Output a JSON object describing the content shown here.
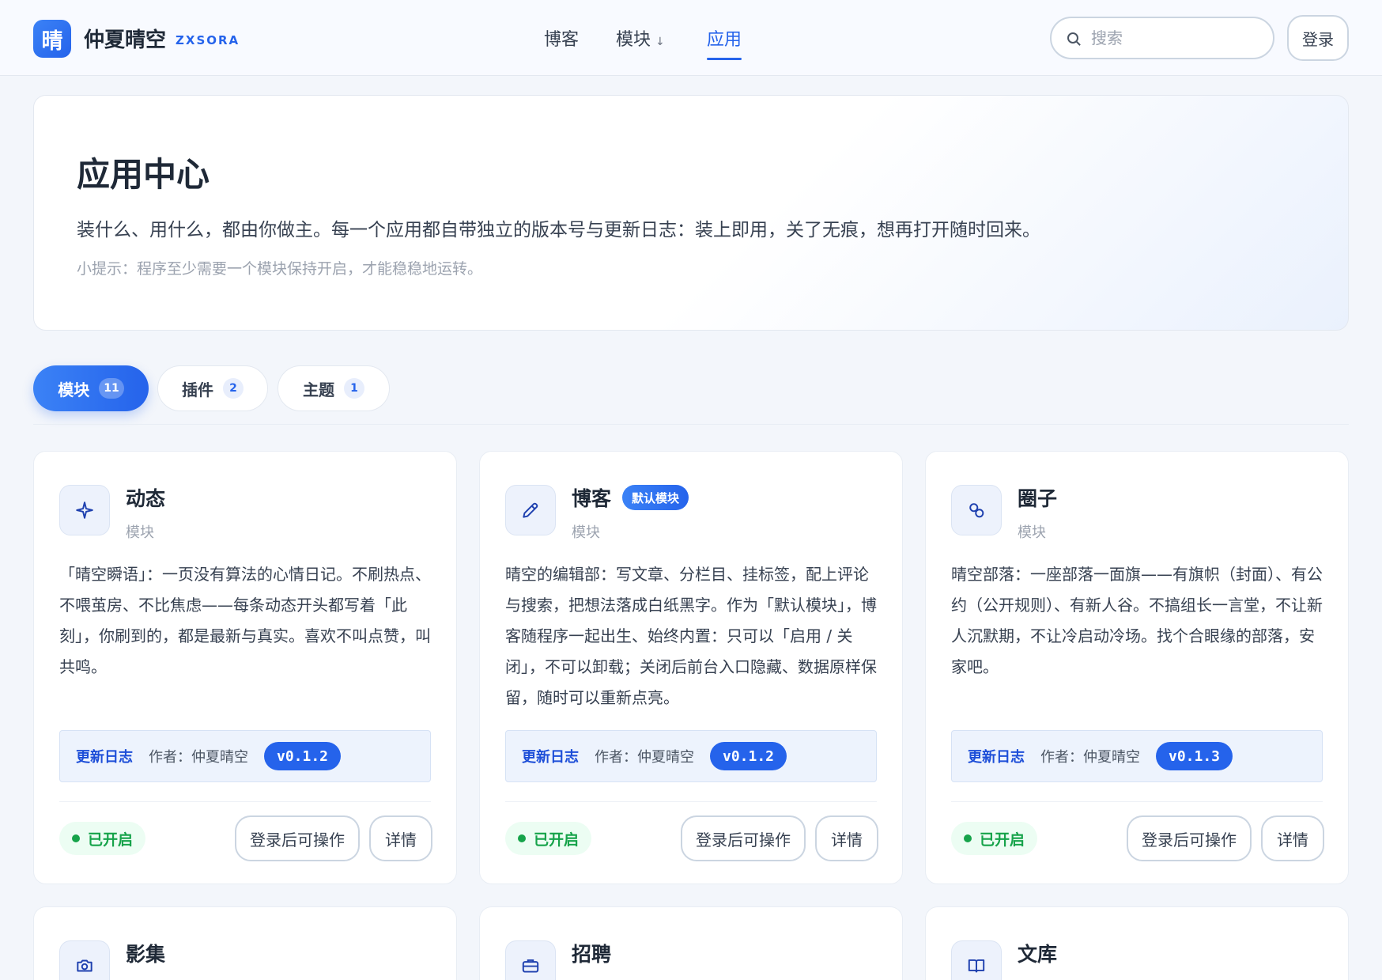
{
  "brand": {
    "logo_char": "晴",
    "name": "仲夏晴空",
    "sub": "ZXSORA"
  },
  "nav": {
    "items": [
      {
        "label": "博客"
      },
      {
        "label": "模块",
        "arrow": "↓"
      },
      {
        "label": "应用"
      }
    ],
    "active": 2
  },
  "search": {
    "placeholder": "搜索",
    "value": ""
  },
  "login_label": "登录",
  "hero": {
    "title": "应用中心",
    "description": "装什么、用什么，都由你做主。每一个应用都自带独立的版本号与更新日志：装上即用，关了无痕，想再打开随时回来。",
    "tip": "小提示：程序至少需要一个模块保持开启，才能稳稳地运转。"
  },
  "tabs": [
    {
      "label": "模块",
      "count": "11"
    },
    {
      "label": "插件",
      "count": "2"
    },
    {
      "label": "主题",
      "count": "1"
    }
  ],
  "cards": [
    {
      "title": "动态",
      "type": "模块",
      "badge": "",
      "icon": "sparkle-icon",
      "desc": "「晴空瞬语」：一页没有算法的心情日记。不刷热点、不喂茧房、不比焦虑——每条动态开头都写着「此刻」，你刷到的，都是最新与真实。喜欢不叫点赞，叫共鸣。",
      "changelog": "更新日志",
      "author": "作者：仲夏晴空",
      "version": "v0.1.2",
      "status": "已开启",
      "op_label": "登录后可操作",
      "detail_label": "详情"
    },
    {
      "title": "博客",
      "type": "模块",
      "badge": "默认模块",
      "icon": "pencil-icon",
      "desc": "晴空的编辑部：写文章、分栏目、挂标签，配上评论与搜索，把想法落成白纸黑字。作为「默认模块」，博客随程序一起出生、始终内置：只可以「启用 / 关闭」，不可以卸载；关闭后前台入口隐藏、数据原样保留，随时可以重新点亮。",
      "changelog": "更新日志",
      "author": "作者：仲夏晴空",
      "version": "v0.1.2",
      "status": "已开启",
      "op_label": "登录后可操作",
      "detail_label": "详情"
    },
    {
      "title": "圈子",
      "type": "模块",
      "badge": "",
      "icon": "link-circles-icon",
      "desc": "晴空部落：一座部落一面旗——有旗帜（封面）、有公约（公开规则）、有新人谷。不搞组长一言堂，不让新人沉默期，不让冷启动冷场。找个合眼缘的部落，安家吧。",
      "changelog": "更新日志",
      "author": "作者：仲夏晴空",
      "version": "v0.1.3",
      "status": "已开启",
      "op_label": "登录后可操作",
      "detail_label": "详情"
    },
    {
      "title": "影集",
      "icon": "camera-icon"
    },
    {
      "title": "招聘",
      "icon": "briefcase-icon"
    },
    {
      "title": "文库",
      "icon": "book-icon"
    }
  ]
}
